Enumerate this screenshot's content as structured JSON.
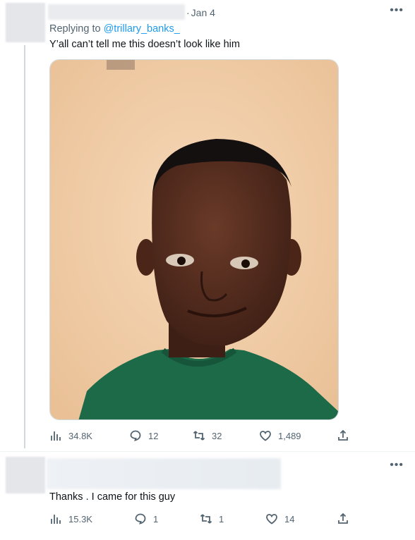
{
  "tweets": [
    {
      "date": "Jan 4",
      "replying_label": "Replying to",
      "replying_handle": "@trillary_banks_",
      "text": "Y’all can’t tell me this doesn’t look like him",
      "more_icon": "more-icon",
      "stats": {
        "views": "34.8K",
        "replies": "12",
        "retweets": "32",
        "likes": "1,489"
      }
    },
    {
      "text": "Thanks . I came for this guy",
      "more_icon": "more-icon",
      "stats": {
        "views": "15.3K",
        "replies": "1",
        "retweets": "1",
        "likes": "14"
      }
    }
  ],
  "colors": {
    "link": "#1d9bf0",
    "muted": "#536471",
    "text": "#0f1419",
    "photo_wall": "#f0c9a4",
    "shirt": "#1c6a48"
  }
}
